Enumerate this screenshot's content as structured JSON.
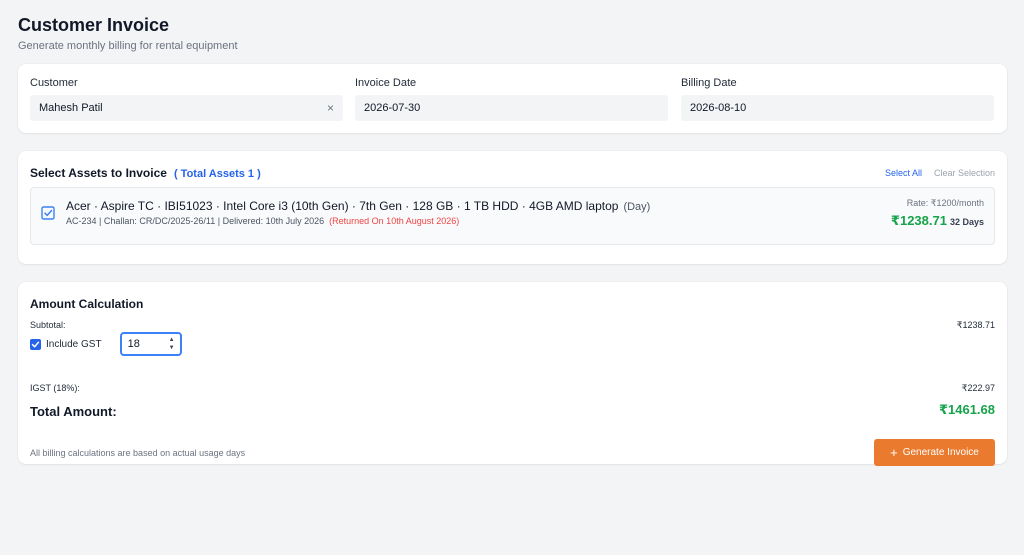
{
  "header": {
    "title": "Customer Invoice",
    "subtitle": "Generate monthly billing for rental equipment"
  },
  "customer_form": {
    "customer_label": "Customer",
    "customer_value": "Mahesh Patil",
    "clear_glyph": "×",
    "invoice_date_label": "Invoice Date",
    "invoice_date_value": "2026-07-30",
    "billing_date_label": "Billing Date",
    "billing_date_value": "2026-08-10"
  },
  "assets": {
    "title": "Select Assets to Invoice",
    "total_label": "( Total Assets 1 )",
    "select_all": "Select All",
    "clear_selection": "Clear Selection",
    "items": [
      {
        "name": "Acer · Aspire TC · IBI51023 · Intel Core i3 (10th Gen) · 7th Gen · 128 GB · 1 TB HDD · 4GB AMD laptop",
        "period": "(Day)",
        "meta": "AC-234 |  Challan: CR/DC/2025-26/11 | Delivered: 10th July 2026",
        "returned": "(Returned On 10th August 2026)",
        "rate": "Rate: ₹1200/month",
        "amount": "₹1238.71",
        "days": "32 Days",
        "checked": true
      }
    ]
  },
  "amount": {
    "title": "Amount Calculation",
    "subtotal_label": "Subtotal:",
    "subtotal_value": "₹1238.71",
    "include_gst_label": "Include GST",
    "gst_rate": "18",
    "igst_label": "IGST (18%):",
    "igst_value": "₹222.97",
    "total_label": "Total Amount:",
    "total_value": "₹1461.68",
    "footnote": "All billing calculations are based on actual usage days",
    "generate_label": "Generate Invoice",
    "generate_glyph": "+"
  },
  "colors": {
    "accent_blue": "#2563eb",
    "success_green": "#16a34a",
    "danger_red": "#ef4444",
    "button_orange": "#ea7a2e"
  }
}
